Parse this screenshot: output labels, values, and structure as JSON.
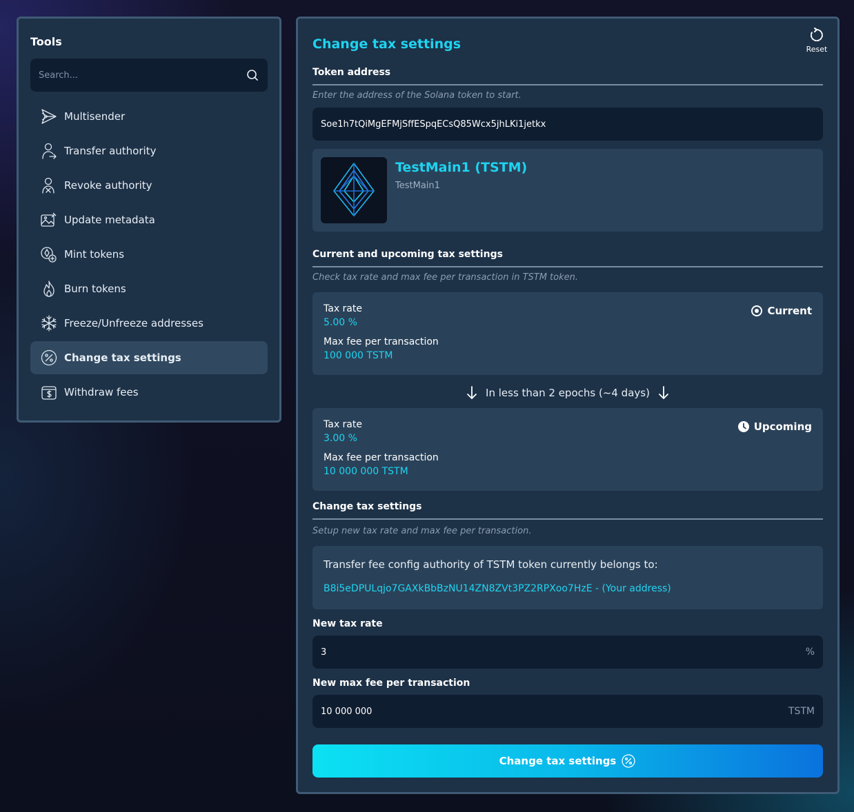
{
  "sidebar": {
    "title": "Tools",
    "search_placeholder": "Search...",
    "items": [
      {
        "label": "Multisender",
        "icon": "send-icon"
      },
      {
        "label": "Transfer authority",
        "icon": "user-transfer-icon"
      },
      {
        "label": "Revoke authority",
        "icon": "user-revoke-icon"
      },
      {
        "label": "Update metadata",
        "icon": "image-edit-icon"
      },
      {
        "label": "Mint tokens",
        "icon": "coin-plus-icon"
      },
      {
        "label": "Burn tokens",
        "icon": "flame-icon"
      },
      {
        "label": "Freeze/Unfreeze addresses",
        "icon": "snowflake-icon"
      },
      {
        "label": "Change tax settings",
        "icon": "percent-icon",
        "active": true
      },
      {
        "label": "Withdraw fees",
        "icon": "wallet-dollar-icon"
      }
    ]
  },
  "main": {
    "title": "Change tax settings",
    "reset_label": "Reset",
    "token_address": {
      "label": "Token address",
      "hint": "Enter the address of the Solana token to start.",
      "value": "Soe1h7tQiMgEFMjSffESpqECsQ85Wcx5jhLKi1jetkx"
    },
    "token": {
      "name": "TestMain1 (TSTM)",
      "subtitle": "TestMain1"
    },
    "current_upcoming": {
      "label": "Current and upcoming tax settings",
      "hint": "Check tax rate and max fee per transaction in TSTM token.",
      "current": {
        "status": "Current",
        "tax_rate_label": "Tax rate",
        "tax_rate_value": "5.00 %",
        "max_fee_label": "Max fee per transaction",
        "max_fee_value": "100 000 TSTM"
      },
      "transition": "In less than 2 epochs (~4 days)",
      "upcoming": {
        "status": "Upcoming",
        "tax_rate_label": "Tax rate",
        "tax_rate_value": "3.00 %",
        "max_fee_label": "Max fee per transaction",
        "max_fee_value": "10 000 000 TSTM"
      }
    },
    "change": {
      "label": "Change tax settings",
      "hint": "Setup new tax rate and max fee per transaction.",
      "authority_text": "Transfer fee config authority of TSTM token currently belongs to:",
      "authority_address": "B8i5eDPULqjo7GAXkBbBzNU14ZN8ZVt3PZ2RPXoo7HzE - (Your address)",
      "new_tax_rate_label": "New tax rate",
      "new_tax_rate_value": "3",
      "new_tax_rate_unit": "%",
      "new_max_fee_label": "New max fee per transaction",
      "new_max_fee_value": "10 000 000",
      "new_max_fee_unit": "TSTM",
      "submit_label": "Change tax settings"
    }
  },
  "colors": {
    "accent": "#1fd3f0",
    "panel": "#1d3147",
    "card": "#2a4259",
    "input": "#0f1d30",
    "border": "#3f5b75"
  }
}
